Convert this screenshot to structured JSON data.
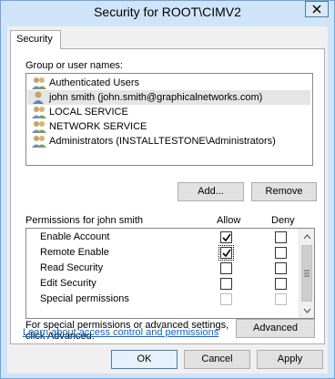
{
  "window": {
    "title": "Security for ROOT\\CIMV2"
  },
  "tabs": [
    {
      "label": "Security"
    }
  ],
  "users": {
    "label": "Group or user names:",
    "items": [
      {
        "label": "Authenticated Users",
        "icon": "group-icon"
      },
      {
        "label": "john smith (john.smith@graphicalnetworks.com)",
        "icon": "user-icon",
        "selected": true
      },
      {
        "label": "LOCAL SERVICE",
        "icon": "group-icon"
      },
      {
        "label": "NETWORK SERVICE",
        "icon": "group-icon"
      },
      {
        "label": "Administrators (INSTALLTESTONE\\Administrators)",
        "icon": "group-icon"
      }
    ],
    "add_label": "Add...",
    "remove_label": "Remove"
  },
  "permissions": {
    "label": "Permissions for john smith",
    "allow_label": "Allow",
    "deny_label": "Deny",
    "rows": [
      {
        "name": "Enable Account",
        "allow": true,
        "deny": false
      },
      {
        "name": "Remote Enable",
        "allow": true,
        "deny": false
      },
      {
        "name": "Read Security",
        "allow": false,
        "deny": false
      },
      {
        "name": "Edit Security",
        "allow": false,
        "deny": false
      },
      {
        "name": "Special permissions",
        "allow": false,
        "deny": false,
        "disabled": true
      }
    ]
  },
  "advanced": {
    "text": "For special permissions or advanced settings, click Advanced.",
    "text_line1": "For special permissions or advanced settings,",
    "text_line2": "click Advanced.",
    "button_label": "Advanced"
  },
  "learn_link": "Learn about access control and permissions",
  "footer": {
    "ok_label": "OK",
    "cancel_label": "Cancel",
    "apply_label": "Apply"
  },
  "colors": {
    "titlebar": "#cfe4f8",
    "link": "#0066cc",
    "dialog": "#f0f0f0"
  }
}
